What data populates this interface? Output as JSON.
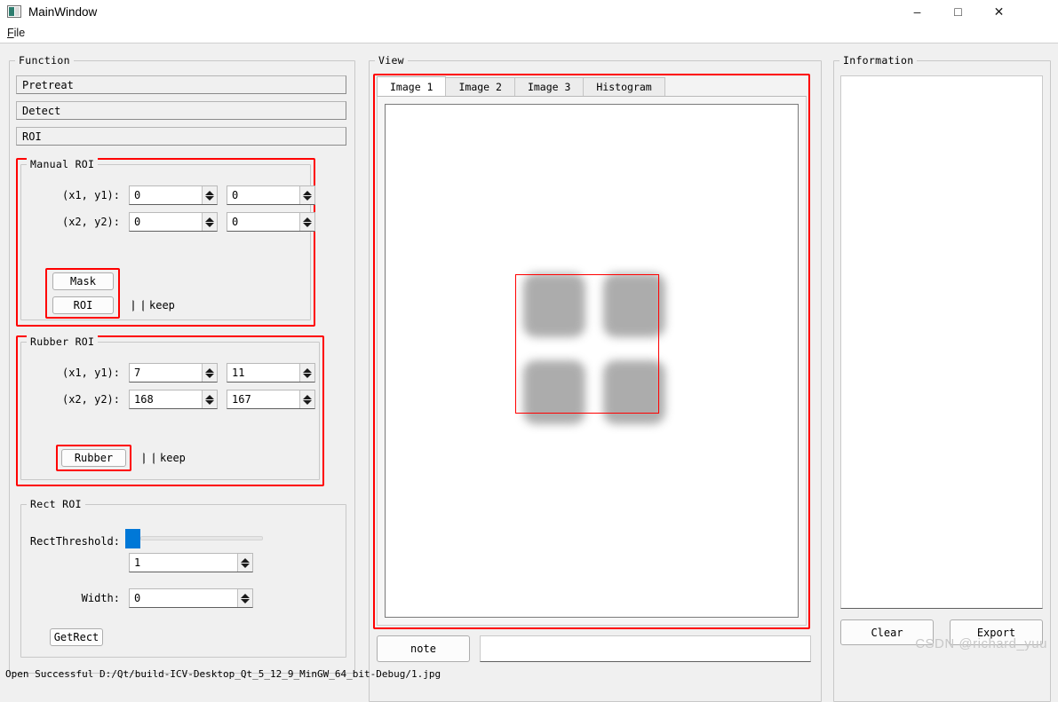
{
  "window": {
    "title": "MainWindow",
    "icon": "app-icon",
    "controls": {
      "minimize": "–",
      "maximize": "□",
      "close": "✕"
    }
  },
  "menubar": {
    "file": "File",
    "file_mnemonic": "F"
  },
  "function_panel": {
    "title": "Function",
    "sections": [
      {
        "label": "Pretreat"
      },
      {
        "label": "Detect"
      },
      {
        "label": "ROI"
      }
    ],
    "manual_roi": {
      "title": "Manual ROI",
      "row1_label": "(x1, y1):",
      "row2_label": "(x2, y2):",
      "x1": "0",
      "y1": "0",
      "x2": "0",
      "y2": "0",
      "mask_button": "Mask",
      "roi_button": "ROI",
      "keep_label": "keep",
      "keep_checked": false
    },
    "rubber_roi": {
      "title": "Rubber ROI",
      "row1_label": "(x1, y1):",
      "row2_label": "(x2, y2):",
      "x1": "7",
      "y1": "11",
      "x2": "168",
      "y2": "167",
      "rubber_button": "Rubber",
      "keep_label": "keep",
      "keep_checked": false
    },
    "rect_roi": {
      "title": "Rect ROI",
      "threshold_label": "RectThreshold:",
      "threshold_value": "1",
      "threshold_slider_percent": 0,
      "width_label": "Width:",
      "width_value": "0",
      "getrect_button": "GetRect"
    }
  },
  "view_panel": {
    "title": "View",
    "tabs": [
      {
        "label": "Image 1",
        "active": true
      },
      {
        "label": "Image 2",
        "active": false
      },
      {
        "label": "Image 3",
        "active": false
      },
      {
        "label": "Histogram",
        "active": false
      }
    ],
    "note_button": "note",
    "note_input_value": "",
    "note_input_placeholder": "",
    "image": {
      "description": "four blurred gray rounded squares with red ROI rectangle overlay",
      "roi_color": "#ff0000"
    }
  },
  "information_panel": {
    "title": "Information",
    "content": "",
    "clear_button": "Clear",
    "export_button": "Export"
  },
  "watermark": "CSDN @richard_yuu",
  "statusbar": {
    "text": "Open Successful D:/Qt/build-ICV-Desktop_Qt_5_12_9_MinGW_64_bit-Debug/1.jpg"
  },
  "colors": {
    "accent": "#0078d7",
    "annotation": "#ff0000",
    "panel_bg": "#f0f0f0"
  }
}
